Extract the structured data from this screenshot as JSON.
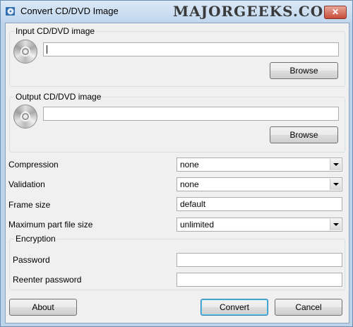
{
  "window": {
    "title": "Convert CD/DVD Image",
    "close_glyph": "✕",
    "watermark": "MAJORGEEKS.COM"
  },
  "input_group": {
    "legend": "Input CD/DVD image",
    "path_value": "",
    "browse_label": "Browse"
  },
  "output_group": {
    "legend": "Output CD/DVD image",
    "path_value": "",
    "browse_label": "Browse"
  },
  "options": {
    "compression": {
      "label": "Compression",
      "value": "none"
    },
    "validation": {
      "label": "Validation",
      "value": "none"
    },
    "frame_size": {
      "label": "Frame size",
      "value": "default"
    },
    "max_part_size": {
      "label": "Maximum part file size",
      "value": "unlimited"
    }
  },
  "encryption": {
    "legend": "Encryption",
    "password_label": "Password",
    "password_value": "",
    "reenter_label": "Reenter password",
    "reenter_value": ""
  },
  "buttons": {
    "about": "About",
    "convert": "Convert",
    "cancel": "Cancel"
  },
  "icons": {
    "title": "disc-app-icon",
    "disc": "cd-disc-icon",
    "dropdown": "chevron-down-icon"
  }
}
